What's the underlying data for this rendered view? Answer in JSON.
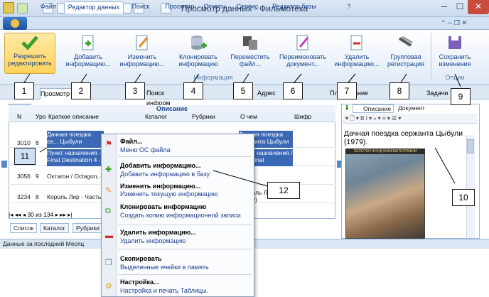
{
  "window": {
    "title": "Просмотр данных - Фильмотека"
  },
  "ribbon_tabs": [
    "Файл",
    "Редактор данных",
    "Поиск",
    "Просмотр",
    "Отчеты",
    "Сервис",
    "Редактор базы",
    "?"
  ],
  "ribbon": {
    "buttons": [
      {
        "label": "Разрешить редактировать",
        "icon": "check-icon"
      },
      {
        "label": "Добавить информацию...",
        "icon": "add-document-icon"
      },
      {
        "label": "Изменить информацию...",
        "icon": "edit-document-icon"
      },
      {
        "label": "Клонировать информацию",
        "icon": "clone-database-icon"
      },
      {
        "label": "Переместить файл...",
        "icon": "move-file-icon"
      },
      {
        "label": "Переименовать документ...",
        "icon": "rename-document-icon"
      },
      {
        "label": "Удалить информацию...",
        "icon": "delete-document-icon"
      },
      {
        "label": "Групповая регистрация",
        "icon": "group-registration-icon"
      },
      {
        "label": "Сохранить изменения",
        "icon": "save-icon"
      }
    ],
    "group_info": "Информация",
    "group_options": "Опции"
  },
  "callouts": [
    "1",
    "2",
    "3",
    "4",
    "5",
    "6",
    "7",
    "8",
    "9",
    "10",
    "11",
    "12"
  ],
  "sub_tabs": [
    "Просмотр",
    "Поиск информ",
    "Адрес",
    "Пл",
    "ание",
    "Задачи"
  ],
  "grid": {
    "band_title": "Описание",
    "headers": [
      "N",
      "Уро",
      "Краткое описание",
      "Каталог",
      "Рубрики",
      "О чем",
      "Шифр"
    ],
    "rows": [
      {
        "n": "",
        "uro": "",
        "desc": "Дачная поездка се... Цыбули",
        "about": "Дачная поездка сержанта Цыбули"
      },
      {
        "n": "3010",
        "uro": "8",
        "desc": "Пункт назначения - Final Destination 4 -",
        "about": "Пункт назначения / The Final"
      },
      {
        "n": "3056",
        "uro": "9",
        "desc": "Октагон / Octagon, (",
        "about": ""
      },
      {
        "n": "3234",
        "uro": "8",
        "desc": "Король Лир - Часть",
        "about": "Король Лир, 1970)"
      }
    ],
    "pager": "30 из 134",
    "bottom_tabs": [
      "Список",
      "Каталог",
      "Рубрики"
    ]
  },
  "status": {
    "text": "Данные за последний Месяц"
  },
  "right_panel": {
    "tabs": [
      "Описание",
      "Документ"
    ],
    "title": "Дачная поездка сержанта Цыбули (1979).",
    "poster_banner": "ЗОЛОТОЙ ФОНД КИНЕМАТОГРАФИИ"
  },
  "context_menu": {
    "items": [
      {
        "title": "Файл...",
        "desc": "Меню ОС файла",
        "icon": "flag-icon"
      },
      {
        "title": "Добавить информацию...",
        "desc": "Добавить информацию в базу",
        "icon": "add-document-icon"
      },
      {
        "title": "Изменить информацию...",
        "desc": "Изменить текущую информацию",
        "icon": "edit-document-icon"
      },
      {
        "title": "Клонировать информацию",
        "desc": "Создать копию информационной записи",
        "icon": "clone-icon"
      },
      {
        "title": "Удалить информацию...",
        "desc": "Удалить информацию",
        "icon": "delete-document-icon"
      },
      {
        "title": "Скопировать",
        "desc": "Выделенные ячейки в память",
        "icon": "copy-icon"
      },
      {
        "title": "Настройка...",
        "desc": "Настройка и печать Таблицы.",
        "icon": "settings-icon"
      }
    ]
  },
  "colors": {
    "accent": "#15428b",
    "selection": "#3a68b4",
    "highlight": "#ffd35a"
  }
}
